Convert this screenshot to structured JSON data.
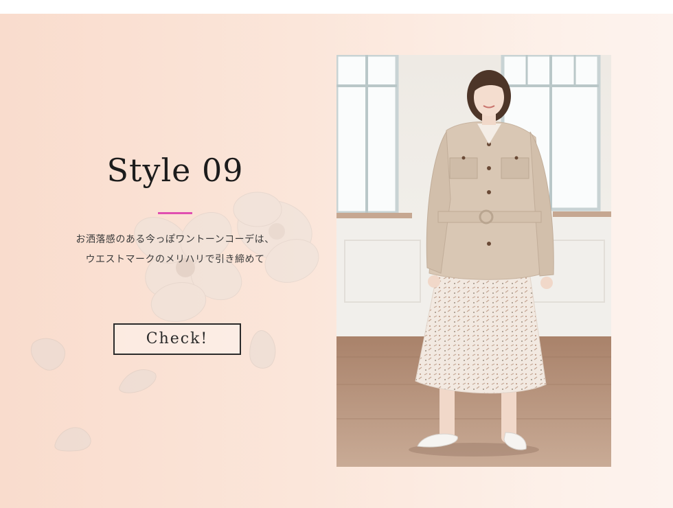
{
  "style": {
    "title": "Style 09",
    "accent_color": "#e04fb0",
    "description_lines": [
      "お洒落感のある今っぽワントーンコーデは、",
      "ウエストマークのメリハリで引き締めて"
    ],
    "check_label": "Check!"
  },
  "icons": {
    "flower": "cherry-blossom-illustration",
    "petals": "falling-petals"
  },
  "colors": {
    "background_left": "#f9dccd",
    "background_right": "#fdf3ee",
    "jacket": "#d9c7b4",
    "skirt": "#f1e8e0"
  }
}
